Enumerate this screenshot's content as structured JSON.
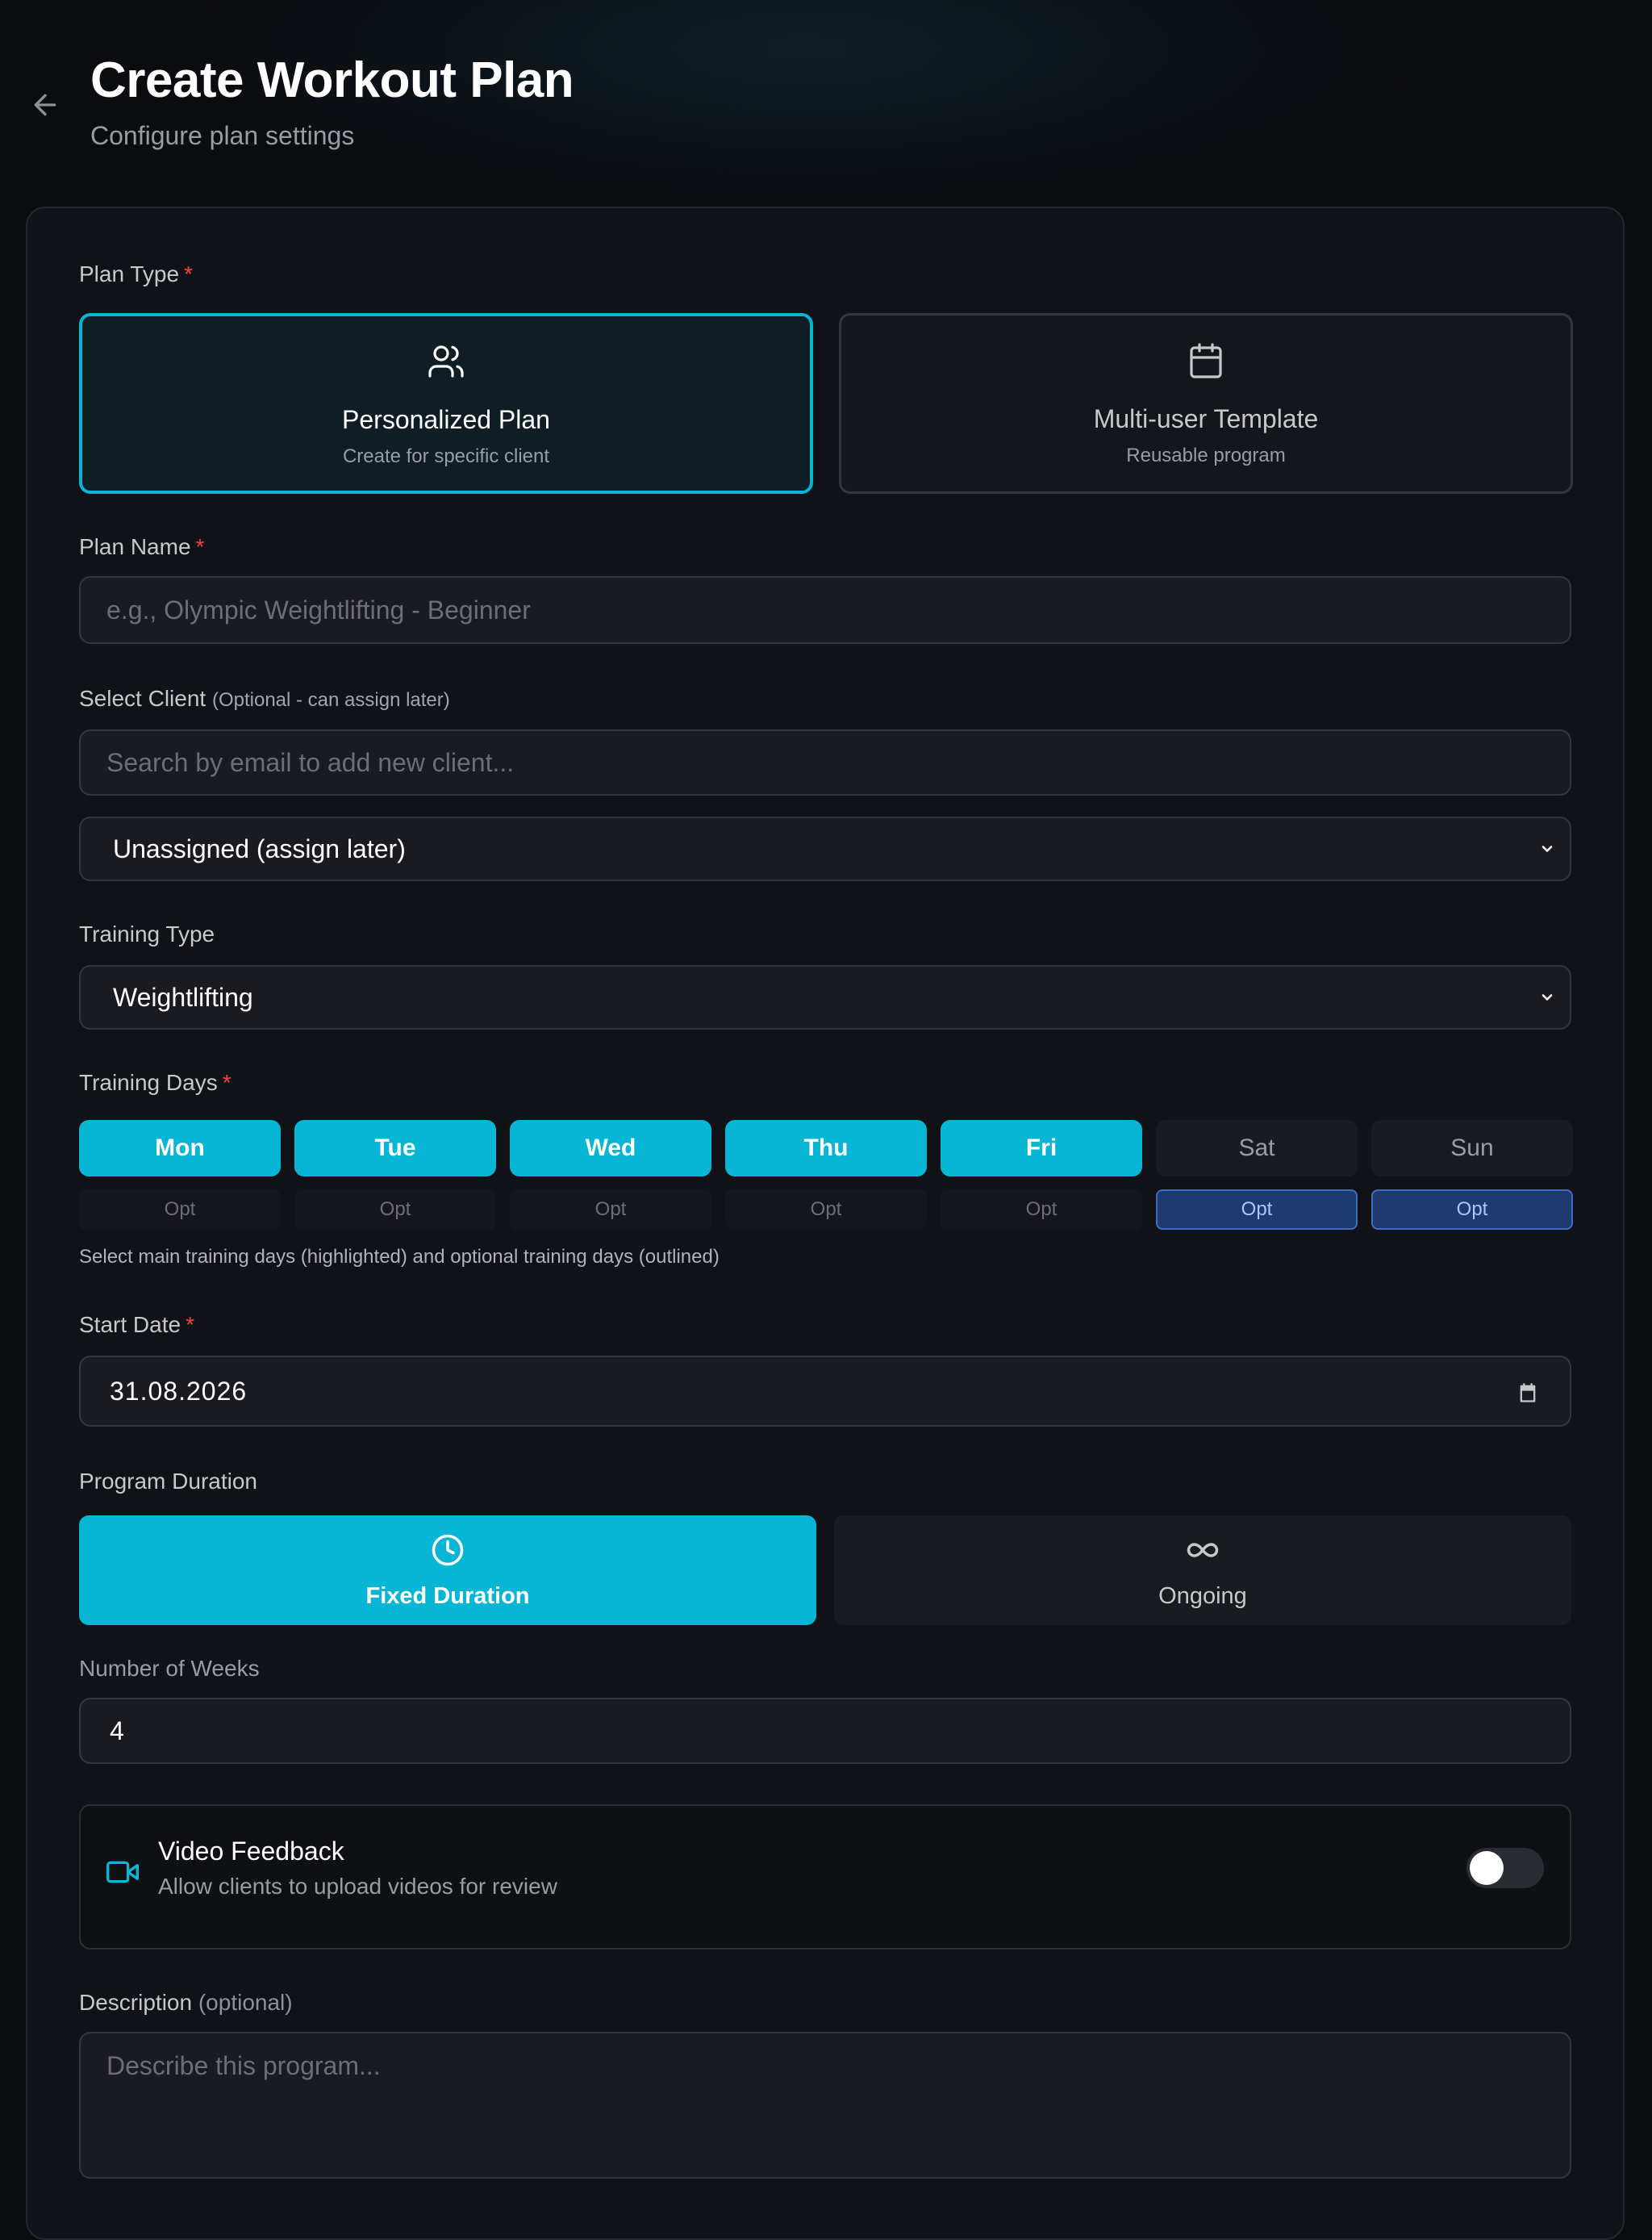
{
  "header": {
    "title": "Create Workout Plan",
    "subtitle": "Configure plan settings"
  },
  "plan_type": {
    "label": "Plan Type",
    "required": "*",
    "options": [
      {
        "title": "Personalized Plan",
        "subtitle": "Create for specific client",
        "icon": "users-icon",
        "selected": true
      },
      {
        "title": "Multi-user Template",
        "subtitle": "Reusable program",
        "icon": "calendar-icon",
        "selected": false
      }
    ]
  },
  "plan_name": {
    "label": "Plan Name",
    "required": "*",
    "placeholder": "e.g., Olympic Weightlifting - Beginner"
  },
  "client": {
    "label": "Select Client",
    "label_note": "(Optional - can assign later)",
    "search_placeholder": "Search by email to add new client...",
    "selected": "Unassigned (assign later)"
  },
  "training_type": {
    "label": "Training Type",
    "selected": "Weightlifting"
  },
  "training_days": {
    "label": "Training Days",
    "required": "*",
    "days": [
      {
        "name": "Mon",
        "main": true,
        "optional_label": "Opt",
        "optional": false
      },
      {
        "name": "Tue",
        "main": true,
        "optional_label": "Opt",
        "optional": false
      },
      {
        "name": "Wed",
        "main": true,
        "optional_label": "Opt",
        "optional": false
      },
      {
        "name": "Thu",
        "main": true,
        "optional_label": "Opt",
        "optional": false
      },
      {
        "name": "Fri",
        "main": true,
        "optional_label": "Opt",
        "optional": false
      },
      {
        "name": "Sat",
        "main": false,
        "optional_label": "Opt",
        "optional": true
      },
      {
        "name": "Sun",
        "main": false,
        "optional_label": "Opt",
        "optional": true
      }
    ],
    "hint": "Select main training days (highlighted) and optional training days (outlined)"
  },
  "start_date": {
    "label": "Start Date",
    "required": "*",
    "value": "31.08.2026"
  },
  "duration": {
    "label": "Program Duration",
    "options": [
      {
        "label": "Fixed Duration",
        "icon": "clock-icon",
        "selected": true
      },
      {
        "label": "Ongoing",
        "icon": "infinity-icon",
        "selected": false
      }
    ],
    "weeks_label": "Number of Weeks",
    "weeks_value": "4"
  },
  "video_feedback": {
    "title": "Video Feedback",
    "subtitle": "Allow clients to upload videos for review",
    "enabled": false
  },
  "description": {
    "label": "Description",
    "label_note": "(optional)",
    "placeholder": "Describe this program..."
  },
  "colors": {
    "accent": "#06b6d4",
    "background": "#0b0c10",
    "required": "#ef4444",
    "optional_selected": "#1e3a6e"
  }
}
